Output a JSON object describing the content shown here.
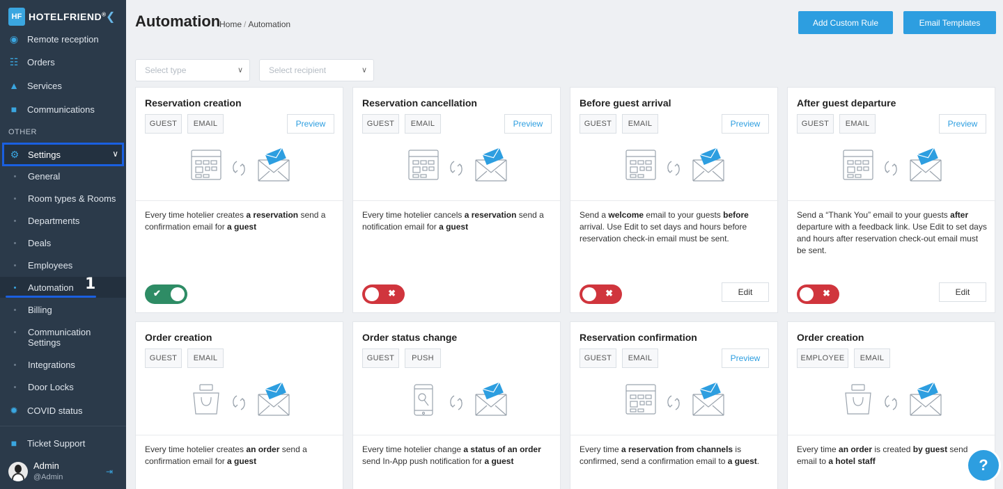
{
  "brand": {
    "logo": "HF",
    "name": "HOTELFRIEND",
    "trademark": "®"
  },
  "sidebar": {
    "top_items": [
      {
        "label": "Remote reception",
        "icon": "reception-icon"
      },
      {
        "label": "Orders",
        "icon": "cart-icon"
      },
      {
        "label": "Services",
        "icon": "bell-icon"
      },
      {
        "label": "Communications",
        "icon": "chat-icon"
      }
    ],
    "section_label": "OTHER",
    "settings_label": "Settings",
    "sub_items": [
      "General",
      "Room types & Rooms",
      "Departments",
      "Deals",
      "Employees",
      "Automation",
      "Billing",
      "Communication Settings",
      "Integrations",
      "Door Locks"
    ],
    "covid_label": "COVID status",
    "ticket_label": "Ticket Support",
    "annotation": "1",
    "user": {
      "name": "Admin",
      "handle": "@Admin"
    }
  },
  "header": {
    "title": "Automation",
    "breadcrumb": [
      "Home",
      "Automation"
    ],
    "breadcrumb_sep": "/",
    "add_rule": "Add Custom Rule",
    "email_templates": "Email Templates"
  },
  "filters": {
    "type_placeholder": "Select type",
    "recipient_placeholder": "Select recipient"
  },
  "cards": [
    {
      "title": "Reservation creation",
      "tags": [
        "GUEST",
        "EMAIL"
      ],
      "preview": "Preview",
      "desc": [
        {
          "t": "Every time hotelier creates "
        },
        {
          "b": "a reservation"
        },
        {
          "t": " send a confirmation email for "
        },
        {
          "b": "a guest"
        }
      ],
      "toggle": "on"
    },
    {
      "title": "Reservation cancellation",
      "tags": [
        "GUEST",
        "EMAIL"
      ],
      "preview": "Preview",
      "desc": [
        {
          "t": "Every time hotelier cancels "
        },
        {
          "b": "a reservation"
        },
        {
          "t": " send a notification email for "
        },
        {
          "b": "a guest"
        }
      ],
      "toggle": "off"
    },
    {
      "title": "Before guest arrival",
      "tags": [
        "GUEST",
        "EMAIL"
      ],
      "preview": "Preview",
      "desc": [
        {
          "t": "Send a "
        },
        {
          "b": "welcome"
        },
        {
          "t": " email to your guests "
        },
        {
          "b": "before"
        },
        {
          "t": " arrival. Use Edit to set days and hours before reservation check-in email must be sent."
        }
      ],
      "toggle": "off",
      "edit": "Edit"
    },
    {
      "title": "After guest departure",
      "tags": [
        "GUEST",
        "EMAIL"
      ],
      "preview": "Preview",
      "desc": [
        {
          "t": "Send a “Thank You” email to your guests "
        },
        {
          "b": "after"
        },
        {
          "t": " departure with a feedback link. Use Edit to set days and hours after reservation check-out email must be sent."
        }
      ],
      "toggle": "off",
      "edit": "Edit"
    },
    {
      "title": "Order creation",
      "tags": [
        "GUEST",
        "EMAIL"
      ],
      "desc": [
        {
          "t": "Every time hotelier creates "
        },
        {
          "b": "an order"
        },
        {
          "t": " send a confirmation email for "
        },
        {
          "b": "a guest"
        }
      ]
    },
    {
      "title": "Order status change",
      "tags": [
        "GUEST",
        "PUSH"
      ],
      "desc": [
        {
          "t": "Every time hotelier change "
        },
        {
          "b": "a status of an order"
        },
        {
          "t": " send In-App push notification for "
        },
        {
          "b": "a guest"
        }
      ]
    },
    {
      "title": "Reservation confirmation",
      "tags": [
        "GUEST",
        "EMAIL"
      ],
      "preview": "Preview",
      "desc": [
        {
          "t": "Every time "
        },
        {
          "b": "a reservation from channels"
        },
        {
          "t": " is confirmed, send a confirmation email to "
        },
        {
          "b": "a guest"
        },
        {
          "t": "."
        }
      ]
    },
    {
      "title": "Order creation",
      "tags": [
        "EMPLOYEE",
        "EMAIL"
      ],
      "desc": [
        {
          "t": "Every time "
        },
        {
          "b": "an order"
        },
        {
          "t": " is created "
        },
        {
          "b": "by guest"
        },
        {
          "t": " send email to "
        },
        {
          "b": "a hotel staff"
        }
      ]
    }
  ],
  "toggle_marks": {
    "on": "✔",
    "off": "✖"
  },
  "help": "?"
}
